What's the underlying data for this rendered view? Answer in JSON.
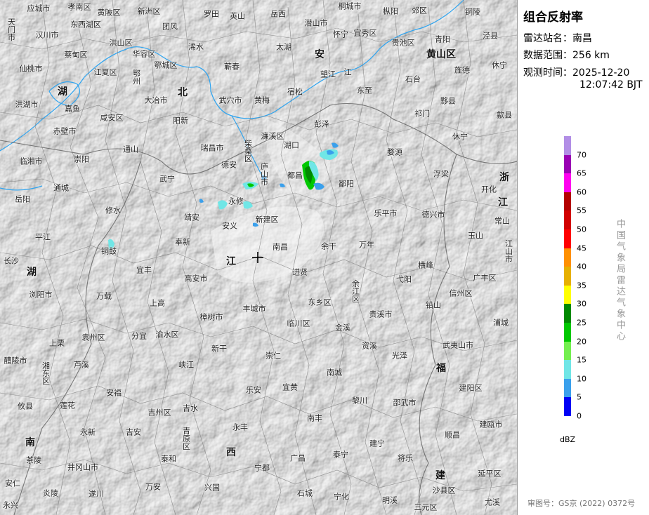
{
  "panel": {
    "title": "组合反射率",
    "station_label": "雷达站名：",
    "station_value": "南昌",
    "range_label": "数据范围：",
    "range_value": "256 km",
    "time_label": "观测时间：",
    "time_date": "2025-12-20",
    "time_clock": "12:07:42 BJT",
    "unit": "dBZ",
    "org": "中国气象局雷达气象中心",
    "review": "审图号：GS京 (2022) 0372号"
  },
  "legend": [
    {
      "value": "70",
      "color": "#b28ee6"
    },
    {
      "value": "65",
      "color": "#9a00b4"
    },
    {
      "value": "60",
      "color": "#ff00f0"
    },
    {
      "value": "55",
      "color": "#b40000"
    },
    {
      "value": "50",
      "color": "#d20000"
    },
    {
      "value": "45",
      "color": "#ff0000"
    },
    {
      "value": "40",
      "color": "#ff9000"
    },
    {
      "value": "35",
      "color": "#e6b000"
    },
    {
      "value": "30",
      "color": "#ffff00"
    },
    {
      "value": "25",
      "color": "#008a00"
    },
    {
      "value": "20",
      "color": "#00c800"
    },
    {
      "value": "15",
      "color": "#73ef4f"
    },
    {
      "value": "10",
      "color": "#70e6e6"
    },
    {
      "value": "5",
      "color": "#3aa0ec"
    },
    {
      "value": "0",
      "color": "#0000f5"
    }
  ],
  "map_labels": {
    "yingcheng": "应城市",
    "xiaonan": "孝南区",
    "huangpi": "黄陂区",
    "xinzhou": "新洲区",
    "luotian": "罗田",
    "yingshan": "英山",
    "yuexi": "岳西",
    "tongcheng": "桐城市",
    "zongyang": "枞阳",
    "jiaoqu": "郊区",
    "tongling": "铜陵",
    "tianmen": "天门市",
    "hanchuan": "汉川市",
    "dongxihu": "东西湖区",
    "hongshan": "洪山区",
    "tuanfeng": "团风",
    "qianshan": "潜山市",
    "huaining": "怀宁",
    "yixiu": "宜秀区",
    "guichi": "贵池区",
    "qingyang": "青阳",
    "jingxian": "泾县",
    "caidian": "蔡甸区",
    "huarong": "华容区",
    "xishui": "浠水",
    "taihu": "太湖",
    "anqing_prov": "安",
    "huangshan": "黄山区",
    "jingde": "旌德",
    "xiantao": "仙桃市",
    "jiangxia": "江夏区",
    "ezhou": "鄂州",
    "echeng": "鄂城区",
    "qichun": "蕲春",
    "wangjiang": "望江",
    "jiang_char": "江",
    "shitai": "石台",
    "hubei_prov1": "湖",
    "dazhi": "大冶市",
    "hubei_prov2": "北",
    "wuxue": "武穴市",
    "huangmei": "黄梅",
    "susong": "宿松",
    "dongzhi": "东至",
    "yixian": "黟县",
    "xiuning": "休宁",
    "honghu": "洪湖市",
    "jiayu": "嘉鱼",
    "xianan": "咸安区",
    "yangxin": "阳新",
    "pengze": "彭泽",
    "qimen": "祁门",
    "shexian": "歙县",
    "chibi": "赤壁市",
    "ruichang": "瑞昌市",
    "chaisang": "柴桑区",
    "lianxi": "濂溪区",
    "hukou": "湖口",
    "xiuning2": "休宁",
    "wuyuan": "婺源",
    "linxiang": "临湘市",
    "chongyang": "崇阳",
    "tongshan": "通山",
    "dean": "德安",
    "lushan": "庐山市",
    "duchang": "都昌",
    "poyang": "鄱阳",
    "wuyuan2": "浮梁",
    "kaihua": "开化",
    "zhejiang_prov": "浙",
    "jiang_prov2": "江",
    "yueyang": "岳阳",
    "tongcheng2": "通城",
    "wuning": "武宁",
    "yongxiu": "永修",
    "leping": "乐平市",
    "dexing": "德兴市",
    "changshan": "常山",
    "yushan": "玉山",
    "xiushui": "修水",
    "jingan": "靖安",
    "anyi": "安义",
    "xinjian": "新建区",
    "pingjiang": "平江",
    "fengxin": "奉新",
    "nanchang": "南昌",
    "yugan": "余干",
    "wannian": "万年",
    "hengfeng": "横峰",
    "jiangshan": "江山市",
    "liuyang": "浏阳市",
    "tonggu": "铜鼓",
    "yifeng": "宜丰",
    "gaoan": "高安市",
    "jiangxi_prov": "江",
    "jinxian": "进贤",
    "yujiang": "余江区",
    "yiyang": "弋阳",
    "guangfeng": "广丰区",
    "changsha": "长沙",
    "hunan_prov1": "湖",
    "shanggao": "上高",
    "fengcheng": "丰城市",
    "dongxiang": "东乡区",
    "guixi": "贵溪市",
    "xinzhou2": "信州区",
    "qianshan2": "铅山",
    "pucheng": "浦城",
    "wanzai": "万载",
    "zhangshu": "樟树市",
    "linchuan": "临川区",
    "jinxi": "金溪",
    "wuyishan": "武夷山市",
    "liling": "醴陵市",
    "shangli": "上栗",
    "yuanzhou": "袁州区",
    "fenyi": "分宜",
    "yushui": "渝水区",
    "xinggan": "新干",
    "zixi": "资溪",
    "guangze": "光泽",
    "luxi": "芦溪",
    "xiangdong": "湘东区",
    "xiajiang": "峡江",
    "chongren": "崇仁",
    "jianyang": "建阳区",
    "fujian_prov": "福",
    "anfu": "安福",
    "lean": "乐安",
    "yihuang": "宜黄",
    "nancheng": "南城",
    "shaowu": "邵武市",
    "youxian": "攸县",
    "lianhua": "莲花",
    "jizhou": "吉州区",
    "jishui": "吉水",
    "lichuan": "黎川",
    "shunchang": "顺昌",
    "jianou": "建瓯市",
    "yongxin": "永新",
    "jian_county": "吉安",
    "qingyuan": "青原区",
    "yongfeng": "永丰",
    "nanfeng": "南丰",
    "chaling": "茶陵",
    "taihe": "泰和",
    "jiangxi_prov2": "西",
    "guangchang": "广昌",
    "taining": "泰宁",
    "jiangle": "将乐",
    "jinggangshan": "井冈山市",
    "ningdu": "宁都",
    "jianning": "建宁",
    "wanan": "万安",
    "xingguo": "兴国",
    "shicheng": "石城",
    "ninghua": "宁化",
    "mingxi": "明溪",
    "sanyuan": "三元区",
    "shaxian": "沙县区",
    "youxi": "尤溪",
    "yanping": "延平区",
    "anren": "安仁",
    "yanling": "炎陵",
    "suichuan": "遂川",
    "yongxing": "永兴",
    "fujian_prov2": "建",
    "nanyue": "南"
  }
}
